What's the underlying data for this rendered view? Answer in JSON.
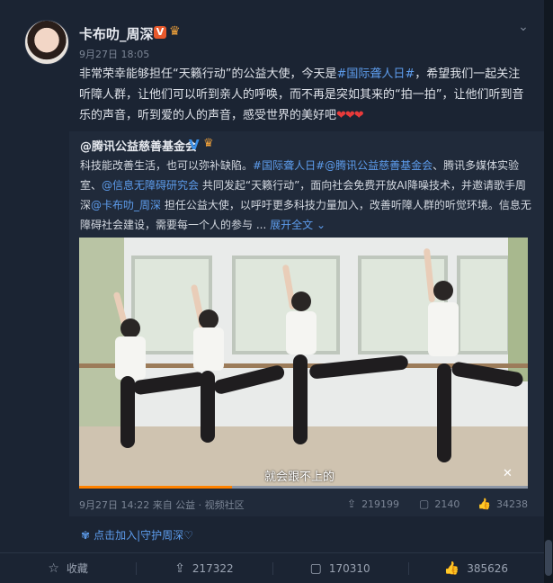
{
  "post": {
    "author": "卡布叻_周深",
    "vip_badge": "V",
    "crown_badge": "♛",
    "time": "9月27日 18:05",
    "menu_icon": "chevron-down-icon",
    "text_part1": "非常荣幸能够担任“天籁行动”的公益大使，今天是",
    "text_link": "#国际聋人日#",
    "text_part2": "，希望我们一起关注听障人群，让他们可以听到亲人的呼唤，而不再是突如其来的“拍一拍”，让他们听到音乐的声音，听到爱的人的声音，感受世界的美好吧",
    "hearts": "❤❤❤"
  },
  "repost": {
    "author": "@腾讯公益慈善基金会",
    "verified": "V",
    "crown": "♛",
    "line1_a": "科技能改善生活，也可以弥补缺陷。",
    "line1_link1": "#国际聋人日#",
    "line1_link2": "@腾讯公益慈善基金会",
    "line1_b": "、腾讯多媒体实验室、",
    "line2_link": "@信息无障碍研究会",
    "line2_a": " 共同发起“天籁行动”，面向社会免费开放AI降噪技术，并邀请歌手周深",
    "line3_link": "@卡布叻_周深",
    "line3_a": " 担任公益大使，以呼吁更多科技力量加入，改善听障人群的听觉环境。信息无障碍社会建设，需要每一个人的参与 ...",
    "expand": "展开全文",
    "expand_icon": "⌄",
    "video": {
      "subtitle": "就会跟不上的",
      "progress": 0.34,
      "mute_icon": "mute-icon"
    },
    "footer": {
      "meta": "9月27日 14:22 来自 公益 · 视频社区",
      "repost_count": "219199",
      "comment_count": "2140",
      "like_count": "34238"
    }
  },
  "join": {
    "icon": "✾",
    "text": "点击加入|守护周深♡"
  },
  "actions": {
    "favorite": "收藏",
    "repost": "217322",
    "comment": "170310",
    "like": "385626"
  },
  "colors": {
    "background": "#1b2433",
    "link": "#5d9cec",
    "accent": "#ff8200"
  }
}
